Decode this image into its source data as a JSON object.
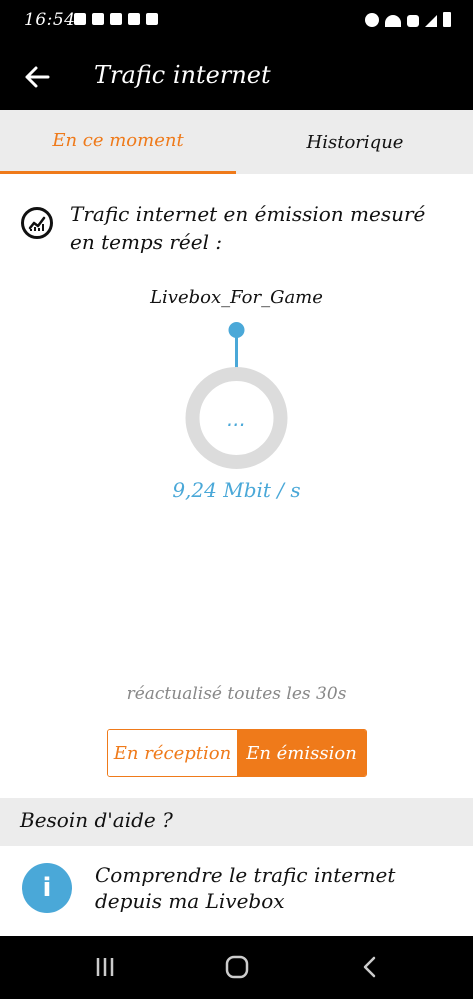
{
  "status_bar": {
    "time": "16:54"
  },
  "app_bar": {
    "title": "Trafic internet"
  },
  "tabs": [
    {
      "label": "En ce moment",
      "active": true
    },
    {
      "label": "Historique",
      "active": false
    }
  ],
  "section": {
    "heading": "Trafic internet en émission mesuré en temps réel :",
    "icon": "chart-up-icon"
  },
  "device": {
    "name": "Livebox_For_Game"
  },
  "gauge": {
    "center_text": "...",
    "value": "9,24 Mbit / s"
  },
  "refresh_text": "réactualisé toutes les 30s",
  "toggle": {
    "reception": "En réception",
    "emission": "En émission",
    "selected": "emission"
  },
  "help": {
    "title": "Besoin d'aide ?",
    "item_text": "Comprendre le trafic internet depuis ma Livebox",
    "icon": "info-icon"
  },
  "colors": {
    "accent": "#ef7a1a",
    "blue": "#4aa8d8",
    "gray": "#ececec"
  }
}
